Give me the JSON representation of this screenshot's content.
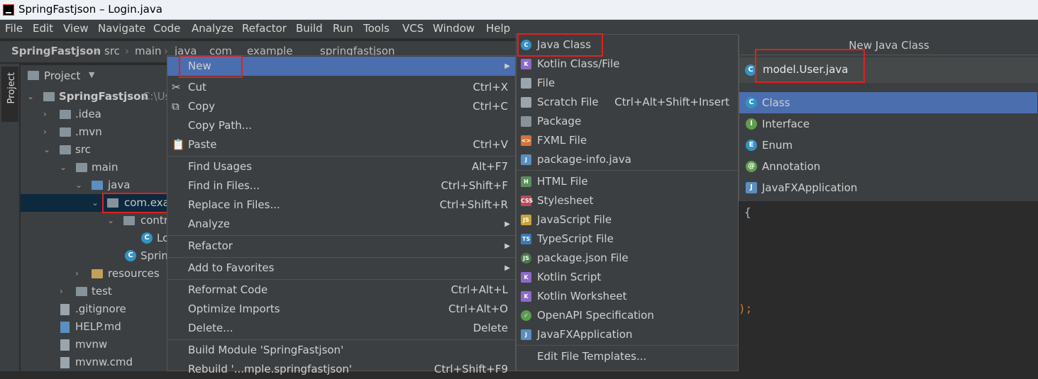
{
  "window": {
    "title": "SpringFastjson – Login.java"
  },
  "menubar": [
    "File",
    "Edit",
    "View",
    "Navigate",
    "Code",
    "Analyze",
    "Refactor",
    "Build",
    "Run",
    "Tools",
    "VCS",
    "Window",
    "Help"
  ],
  "breadcrumb": [
    "SpringFastjson",
    "src",
    "main",
    "java",
    "com",
    "example",
    "springfastjson"
  ],
  "sidebar": {
    "tab_label": "Project"
  },
  "project_panel": {
    "header": "Project",
    "tree": [
      {
        "label": "SpringFastjson",
        "suffix": "C:\\Us"
      },
      {
        "label": ".idea"
      },
      {
        "label": ".mvn"
      },
      {
        "label": "src"
      },
      {
        "label": "main"
      },
      {
        "label": "java"
      },
      {
        "label": "com.exa"
      },
      {
        "label": "contr"
      },
      {
        "label": "Lo"
      },
      {
        "label": "Sprin"
      },
      {
        "label": "resources"
      },
      {
        "label": "test"
      },
      {
        "label": ".gitignore"
      },
      {
        "label": "HELP.md"
      },
      {
        "label": "mvnw"
      },
      {
        "label": "mvnw.cmd"
      }
    ]
  },
  "context_menu": [
    {
      "label": "New",
      "shortcut": ""
    },
    {
      "label": "Cut",
      "shortcut": "Ctrl+X"
    },
    {
      "label": "Copy",
      "shortcut": "Ctrl+C"
    },
    {
      "label": "Copy Path...",
      "shortcut": ""
    },
    {
      "label": "Paste",
      "shortcut": "Ctrl+V"
    },
    {
      "label": "Find Usages",
      "shortcut": "Alt+F7"
    },
    {
      "label": "Find in Files...",
      "shortcut": "Ctrl+Shift+F"
    },
    {
      "label": "Replace in Files...",
      "shortcut": "Ctrl+Shift+R"
    },
    {
      "label": "Analyze",
      "shortcut": ""
    },
    {
      "label": "Refactor",
      "shortcut": ""
    },
    {
      "label": "Add to Favorites",
      "shortcut": ""
    },
    {
      "label": "Reformat Code",
      "shortcut": "Ctrl+Alt+L"
    },
    {
      "label": "Optimize Imports",
      "shortcut": "Ctrl+Alt+O"
    },
    {
      "label": "Delete...",
      "shortcut": "Delete"
    },
    {
      "label": "Build Module 'SpringFastjson'",
      "shortcut": ""
    },
    {
      "label": "Rebuild '...mple.springfastjson'",
      "shortcut": "Ctrl+Shift+F9"
    }
  ],
  "new_submenu": [
    {
      "label": "Java Class",
      "shortcut": ""
    },
    {
      "label": "Kotlin Class/File",
      "shortcut": ""
    },
    {
      "label": "File",
      "shortcut": ""
    },
    {
      "label": "Scratch File",
      "shortcut": "Ctrl+Alt+Shift+Insert"
    },
    {
      "label": "Package",
      "shortcut": ""
    },
    {
      "label": "FXML File",
      "shortcut": ""
    },
    {
      "label": "package-info.java",
      "shortcut": ""
    },
    {
      "label": "HTML File",
      "shortcut": ""
    },
    {
      "label": "Stylesheet",
      "shortcut": ""
    },
    {
      "label": "JavaScript File",
      "shortcut": ""
    },
    {
      "label": "TypeScript File",
      "shortcut": ""
    },
    {
      "label": "package.json File",
      "shortcut": ""
    },
    {
      "label": "Kotlin Script",
      "shortcut": ""
    },
    {
      "label": "Kotlin Worksheet",
      "shortcut": ""
    },
    {
      "label": "OpenAPI Specification",
      "shortcut": ""
    },
    {
      "label": "JavaFXApplication",
      "shortcut": ""
    },
    {
      "label": "Edit File Templates...",
      "shortcut": ""
    }
  ],
  "new_class_dialog": {
    "title": "New Java Class",
    "name_value": "model.User.java",
    "kinds": [
      "Class",
      "Interface",
      "Enum",
      "Annotation",
      "JavaFXApplication"
    ]
  },
  "editor": {
    "brace": "{",
    "tail": ");"
  }
}
